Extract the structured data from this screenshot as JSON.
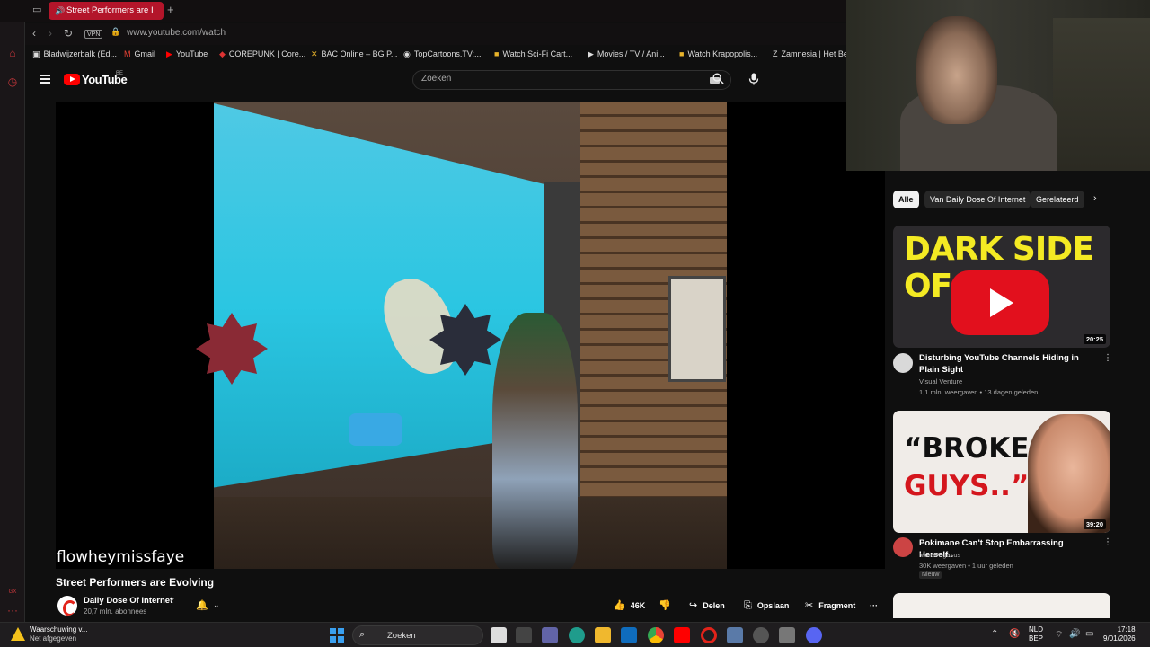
{
  "browser": {
    "active_tab_title": "Street Performers are I",
    "url": "www.youtube.com/watch",
    "vpn_label": "VPN",
    "bookmarks": [
      {
        "label": "Bladwijzerbalk (Ed...",
        "icon": "folder-icon"
      },
      {
        "label": "Gmail",
        "icon": "gmail-icon"
      },
      {
        "label": "YouTube",
        "icon": "youtube-icon"
      },
      {
        "label": "COREPUNK | Core...",
        "icon": "corepunk-icon"
      },
      {
        "label": "BAC Online – BG P...",
        "icon": "bac-icon"
      },
      {
        "label": "TopCartoons.TV:...",
        "icon": "topcartoons-icon"
      },
      {
        "label": "Watch Sci-Fi Cart...",
        "icon": "scifi-icon"
      },
      {
        "label": "Movies / TV / Ani...",
        "icon": "play-icon"
      },
      {
        "label": "Watch Krapopolis...",
        "icon": "krapopolis-icon"
      },
      {
        "label": "Zamnesia | Het Be",
        "icon": "zamnesia-icon"
      }
    ]
  },
  "youtube": {
    "logo_text": "YouTube",
    "country_code": "BE",
    "search_placeholder": "Zoeken"
  },
  "video": {
    "watermark": "flowheymissfaye",
    "title": "Street Performers are Evolving",
    "channel": "Daily Dose Of Internet",
    "subscribers": "20,7 mln. abonnees",
    "actions": {
      "likes": "46K",
      "share": "Delen",
      "save": "Opslaan",
      "clip": "Fragment"
    }
  },
  "sidebar": {
    "chips": [
      "Alle",
      "Van Daily Dose Of Internet",
      "Gerelateerd"
    ],
    "recommendations": [
      {
        "thumb_text": "DARK SIDE OF",
        "duration": "20:25",
        "title": "Disturbing YouTube Channels Hiding in Plain Sight",
        "channel": "Visual Venture",
        "meta": "1,1 mln. weergaven • 13 dagen geleden"
      },
      {
        "thumb_text_1": "“BROKE",
        "thumb_text_2": "GUYS..”",
        "duration": "39:20",
        "title": "Pokimane Can't Stop Embarrassing Herself..",
        "channel": "MorePegasus",
        "meta": "30K weergaven • 1 uur geleden",
        "badge": "Nieuw"
      }
    ]
  },
  "taskbar": {
    "warning_title": "Waarschuwing v...",
    "warning_subtitle": "Net afgegeven",
    "search_label": "Zoeken",
    "language": "NLD",
    "layout": "BEP",
    "time": "17:18",
    "date": "9/01/2026"
  },
  "colors": {
    "accent_red": "#b3152a",
    "youtube_red": "#ff0000",
    "warning_yellow": "#f5c21b"
  }
}
